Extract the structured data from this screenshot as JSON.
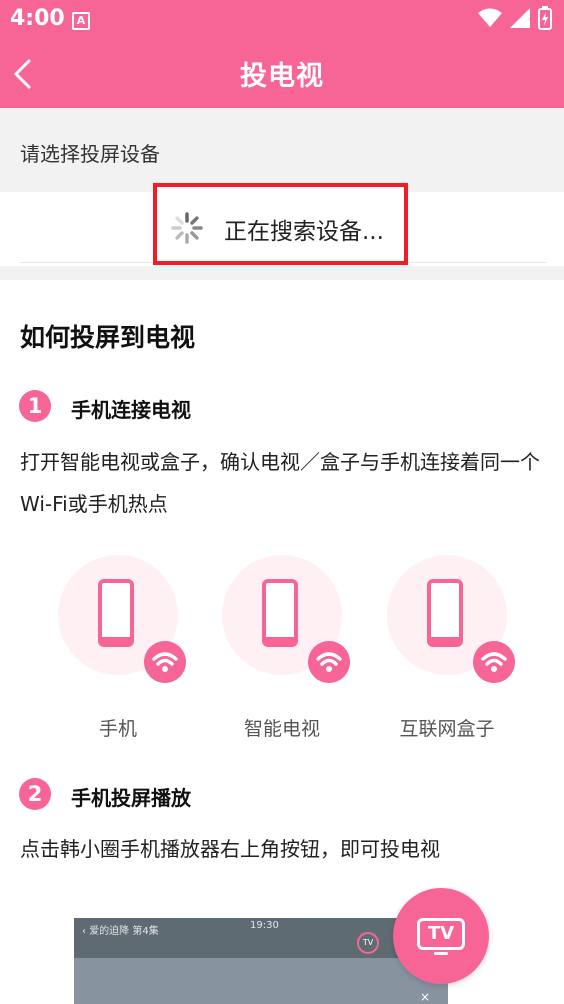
{
  "status_bar": {
    "time": "4:00",
    "notification_badge": "A"
  },
  "header": {
    "title": "投电视",
    "back_icon": "chevron-left-icon"
  },
  "device_select": {
    "label": "请选择投屏设备",
    "searching_text": "正在搜索设备..."
  },
  "guide": {
    "title": "如何投屏到电视",
    "steps": [
      {
        "number": "1",
        "title": "手机连接电视",
        "description": "打开智能电视或盒子，确认电视／盒子与手机连接着同一个Wi-Fi或手机热点"
      },
      {
        "number": "2",
        "title": "手机投屏播放",
        "description": "点击韩小圈手机播放器右上角按钮，即可投电视"
      }
    ],
    "devices": [
      {
        "label": "手机",
        "icon": "phone-icon"
      },
      {
        "label": "智能电视",
        "icon": "phone-icon"
      },
      {
        "label": "互联网盒子",
        "icon": "phone-icon"
      }
    ]
  },
  "video_preview": {
    "title": "爱的迫降 第4集",
    "time": "19:30",
    "tv_badge": "TV",
    "close": "×"
  },
  "fab": {
    "label": "TV",
    "icon": "tv-icon"
  },
  "colors": {
    "accent": "#f76597",
    "highlight_border": "#ee1d26",
    "section_bg": "#f2f2f2"
  }
}
